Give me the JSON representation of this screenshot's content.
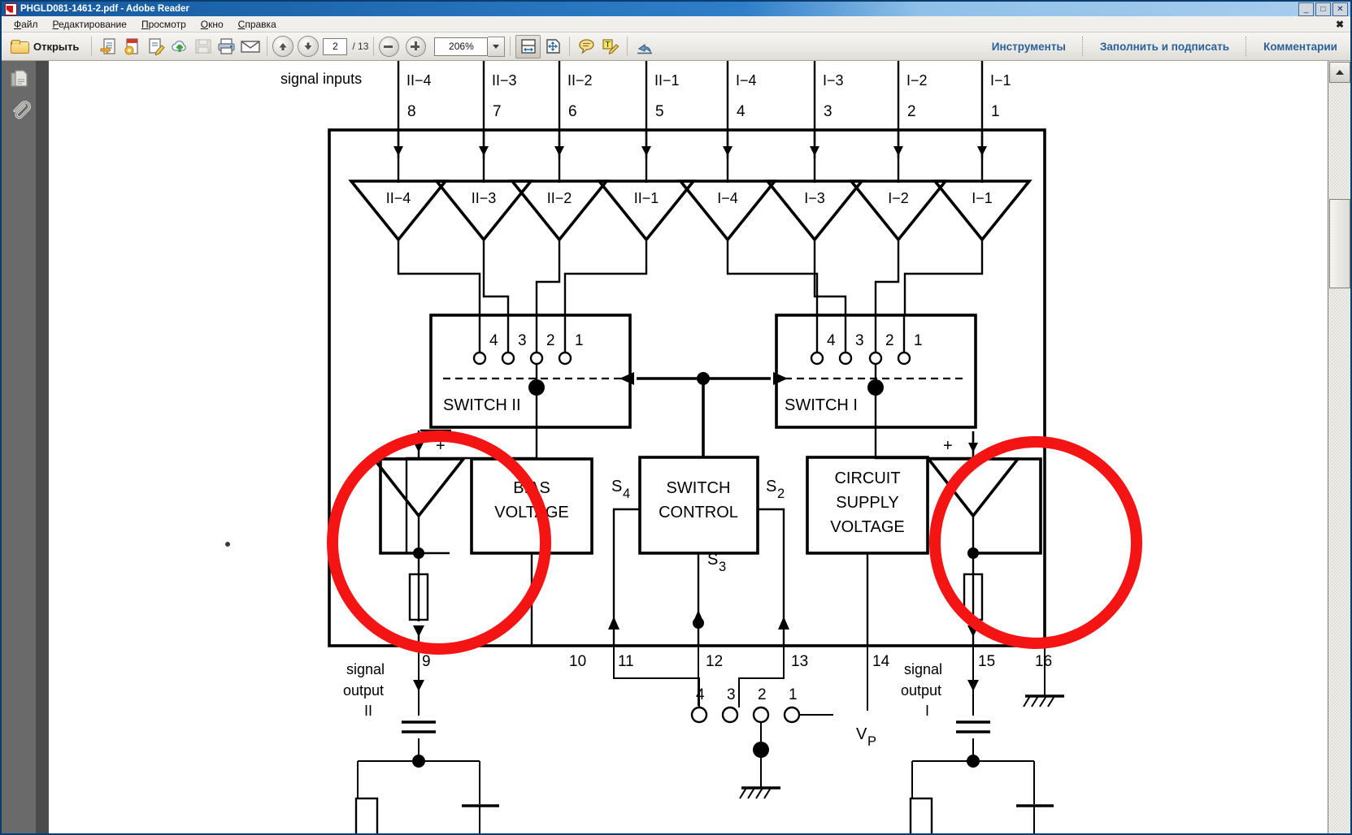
{
  "window": {
    "title": "PHGLD081-1461-2.pdf - Adobe Reader",
    "app_icon": "pdf-icon",
    "minimize": "_",
    "maximize": "□",
    "close": "✕"
  },
  "menubar": {
    "items": [
      {
        "label": "Файл",
        "name": "menu-file"
      },
      {
        "label": "Редактирование",
        "name": "menu-edit"
      },
      {
        "label": "Просмотр",
        "name": "menu-view"
      },
      {
        "label": "Окно",
        "name": "menu-window"
      },
      {
        "label": "Справка",
        "name": "menu-help"
      }
    ],
    "close_glyph": "✖"
  },
  "toolbar": {
    "open_label": "Открыть",
    "open_icon": "folder-icon",
    "icons": [
      {
        "name": "create-pdf-icon"
      },
      {
        "name": "export-pdf-icon"
      },
      {
        "name": "edit-pdf-icon"
      },
      {
        "name": "cloud-upload-icon"
      },
      {
        "name": "save-icon"
      },
      {
        "name": "print-icon"
      },
      {
        "name": "email-icon"
      }
    ],
    "prev_page_icon": "arrow-up-icon",
    "next_page_icon": "arrow-down-icon",
    "page_number": "2",
    "page_total": "/ 13",
    "zoom_out_icon": "minus-circle-icon",
    "zoom_in_icon": "plus-circle-icon",
    "zoom_value": "206%",
    "zoom_dropdown_icon": "chevron-down-icon",
    "fit_width_icon": "fit-width-icon",
    "fit_page_icon": "fit-page-icon",
    "comment_icon": "speech-bubble-icon",
    "highlight_text_icon": "text-highlight-icon",
    "share_icon": "share-icon",
    "right_links": [
      {
        "label": "Инструменты",
        "name": "tools-link"
      },
      {
        "label": "Заполнить и подписать",
        "name": "fill-and-sign-link"
      },
      {
        "label": "Комментарии",
        "name": "comments-link"
      }
    ]
  },
  "navpane": {
    "page_thumbnails_icon": "page-thumbnails-icon",
    "attachments_icon": "paperclip-icon"
  },
  "scrollbar": {
    "up_icon": "scroll-up-arrow-icon"
  },
  "diagram": {
    "signal_inputs_label": "signal  inputs",
    "input_channels": [
      {
        "name": "II−4",
        "pin": "8"
      },
      {
        "name": "II−3",
        "pin": "7"
      },
      {
        "name": "II−2",
        "pin": "6"
      },
      {
        "name": "II−1",
        "pin": "5"
      },
      {
        "name": "I−4",
        "pin": "4"
      },
      {
        "name": "I−3",
        "pin": "3"
      },
      {
        "name": "I−2",
        "pin": "2"
      },
      {
        "name": "I−1",
        "pin": "1"
      }
    ],
    "amplifier_labels": [
      "II−4",
      "II−3",
      "II−2",
      "II−1",
      "I−4",
      "I−3",
      "I−2",
      "I−1"
    ],
    "switch_two": {
      "title": "SWITCH II",
      "contacts": [
        "4",
        "3",
        "2",
        "1"
      ]
    },
    "switch_one": {
      "title": "SWITCH I",
      "contacts": [
        "4",
        "3",
        "2",
        "1"
      ]
    },
    "bias_voltage": {
      "line1": "BIAS",
      "line2": "VOLTAGE"
    },
    "switch_control": {
      "line1": "SWITCH",
      "line2": "CONTROL"
    },
    "circuit_supply": {
      "line1": "CIRCUIT",
      "line2": "SUPPLY",
      "line3": "VOLTAGE"
    },
    "control_signals": {
      "s4": "S",
      "s4sub": "4",
      "s2": "S",
      "s2sub": "2",
      "s3": "S",
      "s3sub": "3"
    },
    "plus_sign": "+",
    "bottom_pins": [
      "9",
      "10",
      "11",
      "12",
      "13",
      "14",
      "15",
      "16"
    ],
    "bottom_contacts": [
      "4",
      "3",
      "2",
      "1"
    ],
    "signal_output_two": {
      "line1": "signal",
      "line2": "output",
      "line3": "II"
    },
    "signal_output_one": {
      "line1": "signal",
      "line2": "output",
      "line3": "I"
    },
    "supply_label": "V",
    "supply_sub": "P",
    "annotation_color": "#f51414"
  }
}
